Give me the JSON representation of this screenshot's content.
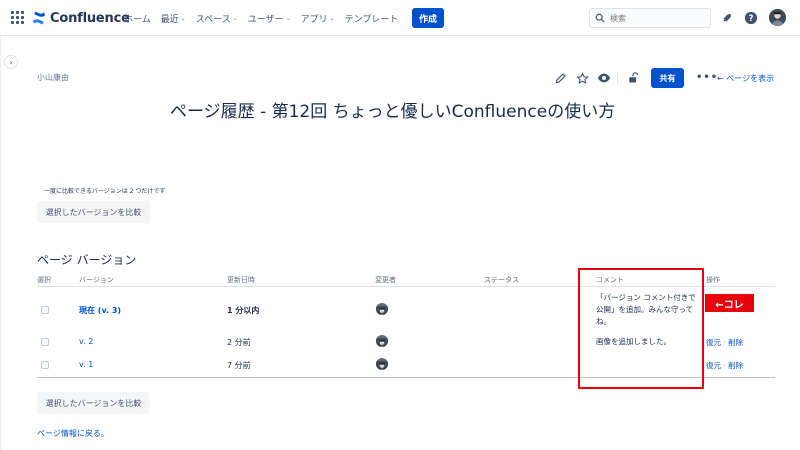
{
  "topnav": {
    "logo_text": "Confluence",
    "menu": [
      {
        "label": "ホーム",
        "dropdown": false
      },
      {
        "label": "最近",
        "dropdown": true
      },
      {
        "label": "スペース",
        "dropdown": true
      },
      {
        "label": "ユーザー",
        "dropdown": true
      },
      {
        "label": "アプリ",
        "dropdown": true
      },
      {
        "label": "テンプレート",
        "dropdown": false
      }
    ],
    "create_label": "作成",
    "search_placeholder": "検索",
    "icons": [
      "app-switcher-icon",
      "notification-icon",
      "help-icon",
      "avatar"
    ]
  },
  "page": {
    "breadcrumb": "小山康由",
    "share_label": "共有",
    "more_label": "•••",
    "view_page_label": "← ページを表示",
    "title": "ページ履歴 - 第12回 ちょっと優しいConfluenceの使い方"
  },
  "compare": {
    "note": "一度に比較できるバージョンは 2 つだけです",
    "button_label": "選択したバージョンを比較"
  },
  "versions": {
    "section_title": "ページ バージョン",
    "headers": {
      "select": "選択",
      "version": "バージョン",
      "updated": "更新日時",
      "author": "変更者",
      "status": "ステータス",
      "comment": "コメント",
      "actions": "操作"
    },
    "rows": [
      {
        "version": "現在 (v. 3)",
        "updated": "1 分以内",
        "comment": "「バージョン コメント付きで公開」を追加。みんな守ってね。",
        "restore": "",
        "delete": ""
      },
      {
        "version": "v. 2",
        "updated": "2 分前",
        "comment": "画像を追加しました。",
        "restore": "復元",
        "delete": "削除"
      },
      {
        "version": "v. 1",
        "updated": "7 分前",
        "comment": "",
        "restore": "復元",
        "delete": "削除"
      }
    ]
  },
  "annotation": {
    "callout": "←コレ",
    "color": "#e8000c"
  },
  "back_link": "ページ情報に戻る。",
  "colors": {
    "primary": "#0052cc",
    "text": "#172b4d",
    "muted": "#6b778c"
  }
}
